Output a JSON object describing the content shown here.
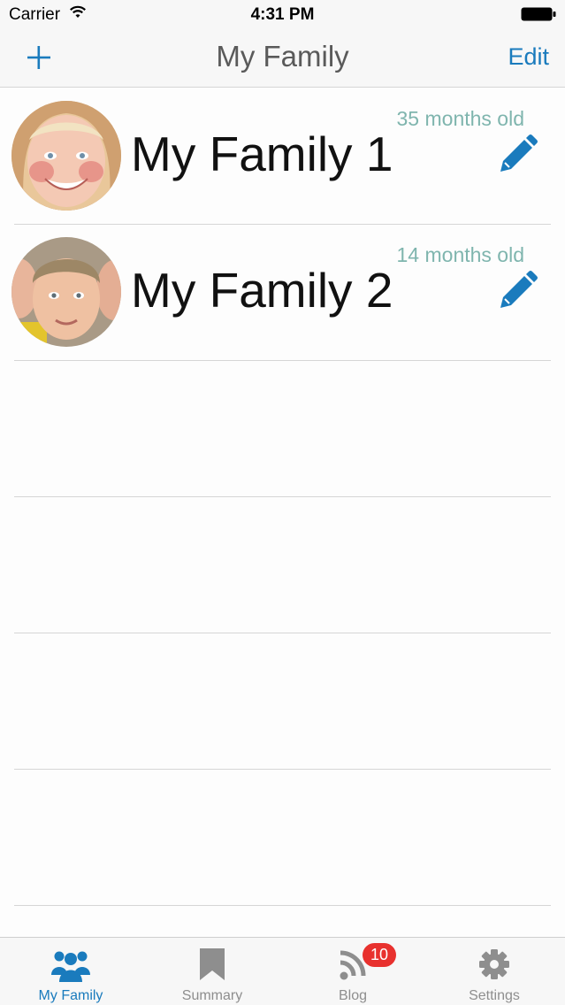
{
  "status_bar": {
    "carrier": "Carrier",
    "time": "4:31 PM"
  },
  "nav": {
    "title": "My Family",
    "edit_label": "Edit"
  },
  "members": [
    {
      "name": "My Family 1",
      "age": "35 months old"
    },
    {
      "name": "My Family 2",
      "age": "14 months old"
    }
  ],
  "tabs": [
    {
      "label": "My Family",
      "icon": "family-icon",
      "active": true
    },
    {
      "label": "Summary",
      "icon": "bookmark-icon",
      "active": false
    },
    {
      "label": "Blog",
      "icon": "rss-icon",
      "active": false,
      "badge": "10"
    },
    {
      "label": "Settings",
      "icon": "gear-icon",
      "active": false
    }
  ],
  "colors": {
    "accent": "#1a7bbd",
    "age_text": "#7fb5ae",
    "badge": "#e8312e"
  }
}
